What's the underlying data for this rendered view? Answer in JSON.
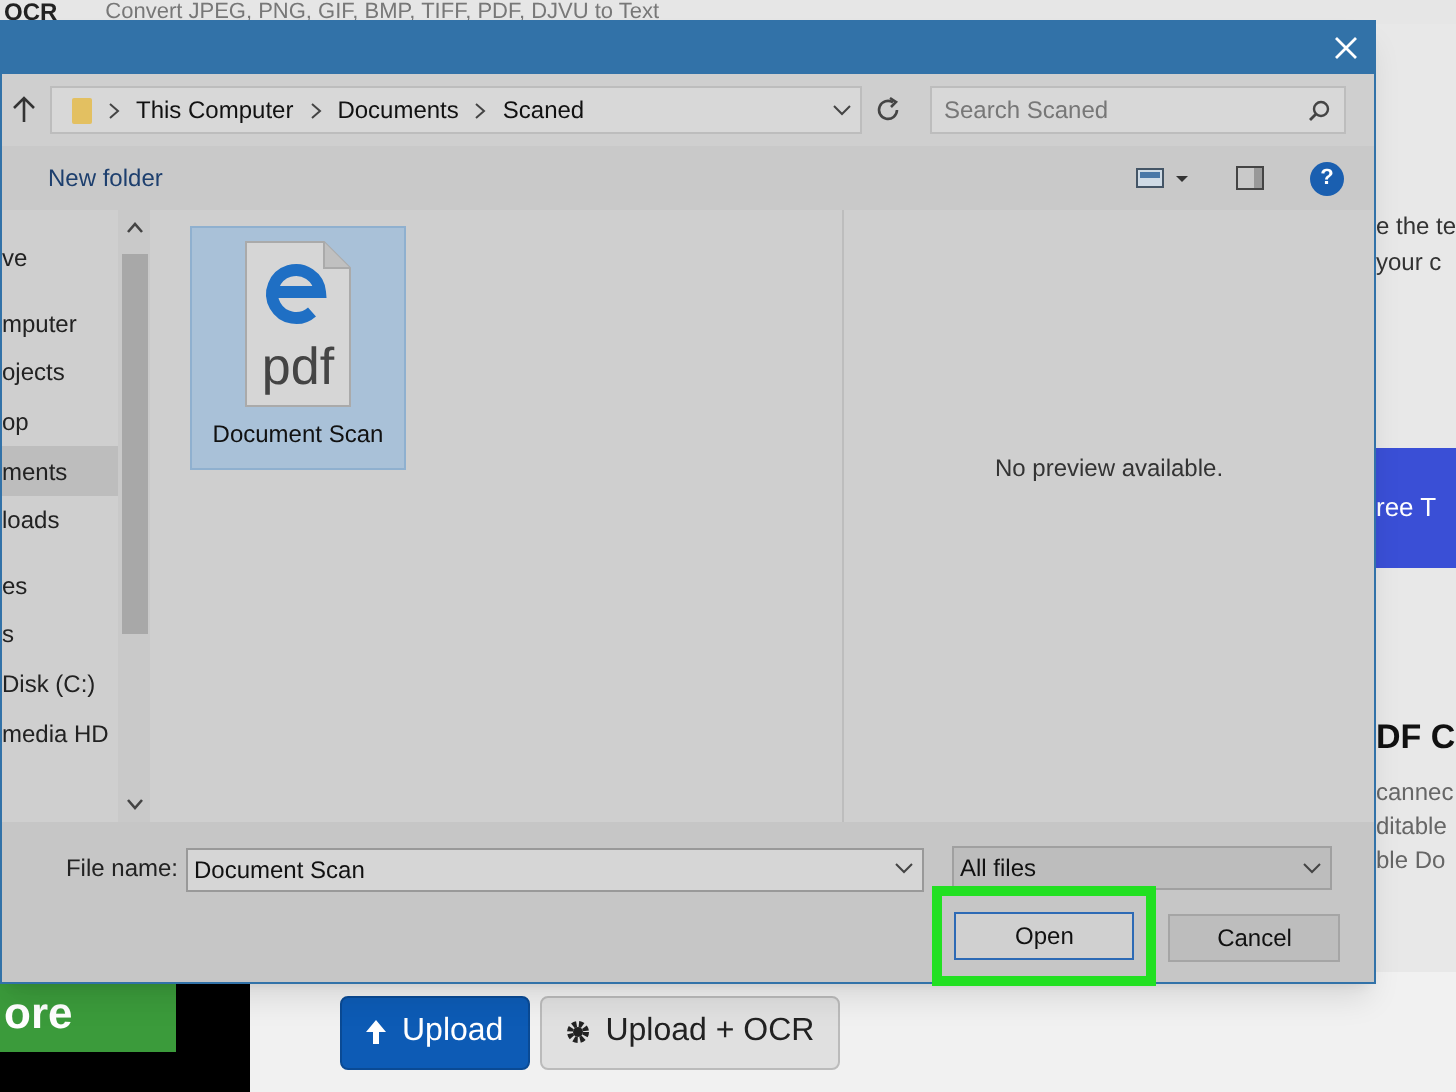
{
  "page": {
    "logo": "OCR",
    "tagline": "Convert JPEG, PNG, GIF, BMP, TIFF, PDF, DJVU to Text",
    "side_texts": [
      "e the te",
      "your c"
    ],
    "banner": "ree T",
    "heading": "DF C",
    "desc_lines": [
      "cannec",
      "ditable",
      "ble Do"
    ],
    "promo_button": "ore",
    "buttons": [
      {
        "kind": "primary",
        "label": "Upload"
      },
      {
        "kind": "secondary",
        "label": "Upload + OCR"
      }
    ]
  },
  "dialog": {
    "breadcrumbs": [
      "This Computer",
      "Documents",
      "Scaned"
    ],
    "search": {
      "placeholder": "Search Scaned"
    },
    "new_folder": "New folder",
    "help": "?",
    "sidebar": {
      "items": [
        {
          "label": "ve",
          "selected": false,
          "group_start": false
        },
        {
          "label": "mputer",
          "selected": false,
          "group_start": true
        },
        {
          "label": "ojects",
          "selected": false,
          "group_start": false
        },
        {
          "label": "op",
          "selected": false,
          "group_start": false
        },
        {
          "label": "ments",
          "selected": true,
          "group_start": false
        },
        {
          "label": "loads",
          "selected": false,
          "group_start": false
        },
        {
          "label": "es",
          "selected": false,
          "group_start": true
        },
        {
          "label": "s",
          "selected": false,
          "group_start": false
        },
        {
          "label": "Disk (C:)",
          "selected": false,
          "group_start": false
        },
        {
          "label": "media HD",
          "selected": false,
          "group_start": false
        }
      ]
    },
    "files": [
      {
        "name": "Document Scan",
        "type_label": "pdf",
        "selected": true
      }
    ],
    "preview": "No preview available.",
    "file_name": {
      "label": "File name:",
      "value": "Document Scan"
    },
    "file_type": "All files",
    "buttons": [
      {
        "kind": "open",
        "label": "Open",
        "highlighted": true
      },
      {
        "kind": "cancel",
        "label": "Cancel",
        "highlighted": false
      }
    ]
  }
}
